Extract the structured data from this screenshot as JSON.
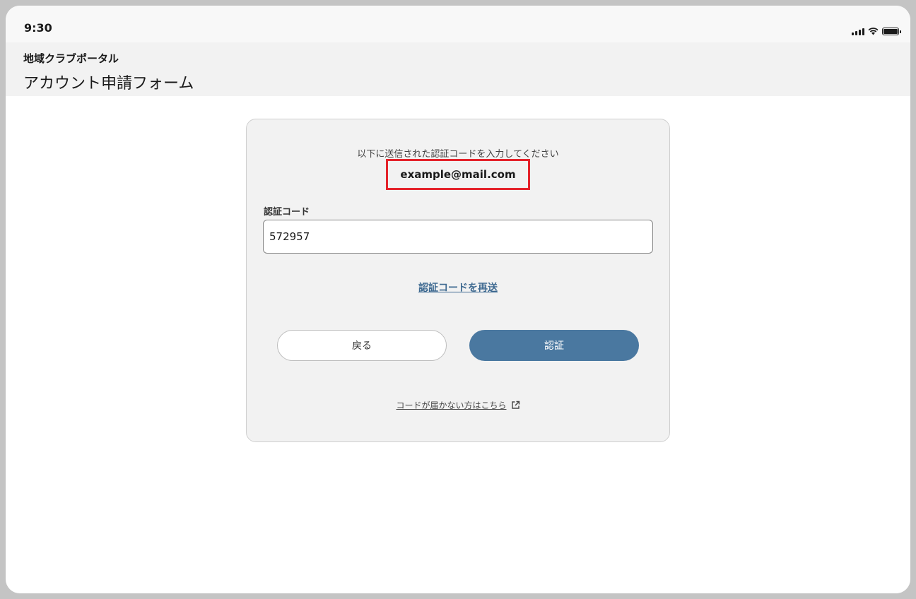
{
  "status_bar": {
    "time": "9:30",
    "icons": [
      "cellular-signal-icon",
      "wifi-icon",
      "battery-icon"
    ]
  },
  "header": {
    "portal_name": "地域クラブポータル",
    "page_title": "アカウント申請フォーム"
  },
  "form": {
    "instruction": "以下に送信された認証コードを入力してください",
    "email": "example@mail.com",
    "code_label": "認証コード",
    "code_value": "572957",
    "resend_link": "認証コードを再送",
    "back_button": "戻る",
    "verify_button": "認証",
    "help_link": "コードが届かない方はこちら",
    "help_icon": "external-link-icon"
  },
  "colors": {
    "accent": "#4a78a0",
    "link": "#3f6a91",
    "highlight": "#e4232b",
    "card_bg": "#f2f2f2"
  }
}
